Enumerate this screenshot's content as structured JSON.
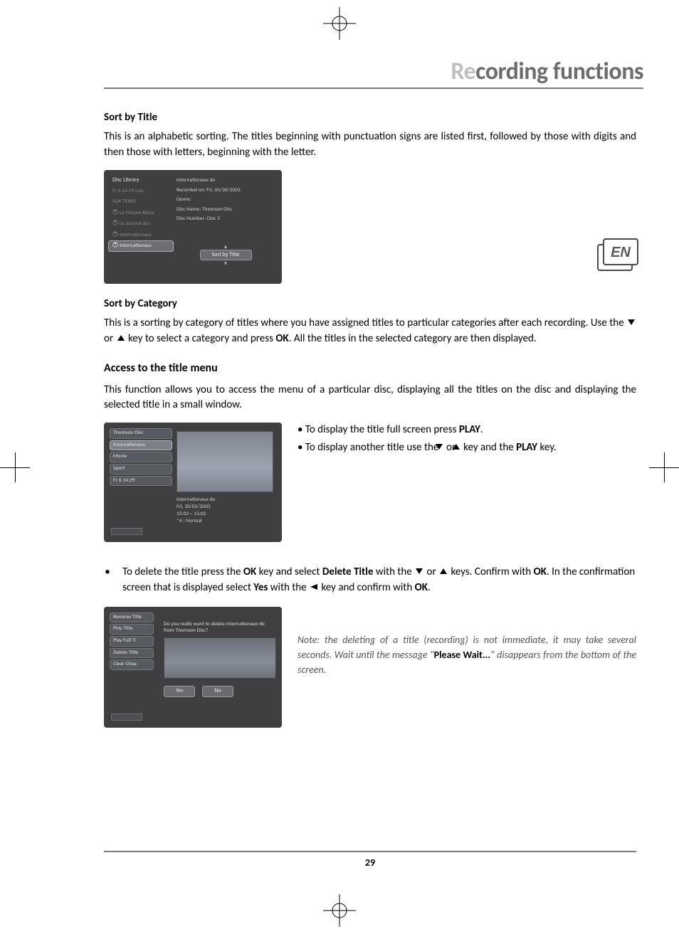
{
  "header": {
    "title_grey": "Re",
    "title_dark": "cording functions"
  },
  "lang_badge": "EN",
  "page_number": "29",
  "section1": {
    "heading": "Sort by Title",
    "para": "This is an alphabetic sorting. The titles beginning with punctuation signs are listed first, followed by those with digits and then those with letters, beginning with the letter."
  },
  "shot1": {
    "sidebar_header": "Disc Library",
    "items": [
      "Fr 6 14:29 Lun",
      "SUR TERRE",
      "La Maison Blanc",
      "Le Journal de l",
      "Internationaux",
      "Internationaux"
    ],
    "selected_index": 5,
    "info_title": "Internationaux de",
    "info_recorded": "Recorded on: Fri, 05/30/2003",
    "info_genre": "Genre:",
    "info_discname": "Disc Name:  Thomson Disc",
    "info_discnum": "Disc Number: Disc 3",
    "sort_button": "Sort by Title"
  },
  "section2": {
    "heading": "Sort by Category",
    "para_pre": "This is a sorting by category of titles where you have assigned titles to particular categories after each recording. Use the ",
    "para_mid": " or ",
    "para_post1": " key to select a category and press ",
    "ok": "OK",
    "para_post2": ". All the titles in the selected category are then displayed."
  },
  "section3": {
    "heading": "Access to the title menu",
    "para": "This function allows you to access the menu of a particular disc, displaying all the titles on the disc and displaying the selected title in a small window.",
    "bullet1_pre": "To display the title full screen press ",
    "play": "PLAY",
    "bullet1_post": ".",
    "bullet2_pre": "To display another title use the ",
    "bullet2_mid": " or ",
    "bullet2_post1": " key and the ",
    "bullet2_post2": " key."
  },
  "shot2": {
    "items": [
      "Thomson Disc",
      "Internationaux",
      "Movie",
      "Sport",
      "Fr 6 14:29"
    ],
    "selected_index": 1,
    "caption_l1": "Internationaux de",
    "caption_l2": "Fri, 30/05/2003",
    "caption_l3": "15:02 ~ 15:02",
    "caption_l4": "*4 : Normal"
  },
  "delete": {
    "pre": "To delete the title press the ",
    "ok": "OK",
    "mid1": " key and select ",
    "delete_title": "Delete Title",
    "mid2": " with the ",
    "mid3": " or ",
    "mid4": " keys. Confirm with ",
    "mid5": ". In the confirmation screen that is displayed select ",
    "yes": "Yes",
    "mid6": " with the ",
    "mid7": " key and confirm with ",
    "end": "."
  },
  "shot3": {
    "menu": [
      "Rename Title",
      "Play Title",
      "Play Full Ti",
      "Delete Title",
      "Clear Chap"
    ],
    "dialog_text": "Do you really want to delete Internationaux de from Thomson Disc?",
    "btn_yes": "Yes",
    "btn_no": "No"
  },
  "note": {
    "pre": "Note: the deleting of a title (recording) is not immediate, it may take several seconds. Wait until the message \"",
    "bold": "Please Wait...",
    "post": "\" disappears from the bottom of the screen."
  }
}
